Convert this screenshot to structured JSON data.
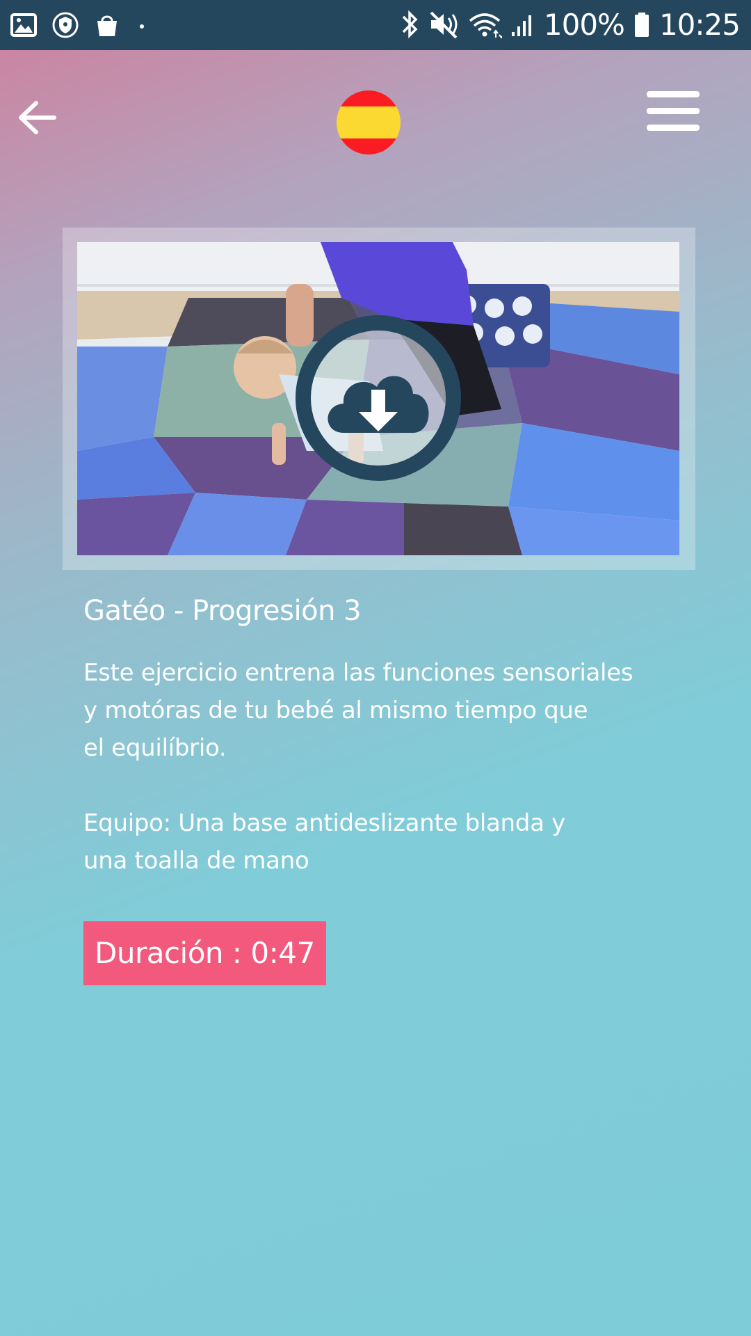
{
  "status_bar": {
    "battery_text": "100%",
    "time": "10:25",
    "icons_left": [
      "image-icon",
      "shield-icon",
      "shopping-bag-icon",
      "dot-icon"
    ],
    "icons_right": [
      "bluetooth-icon",
      "mute-icon",
      "wifi-icon",
      "signal-icon",
      "battery-icon"
    ]
  },
  "header": {
    "back_icon": "arrow-left-icon",
    "language_flag": "spain-flag-icon",
    "menu_icon": "hamburger-menu-icon"
  },
  "video": {
    "thumbnail": "baby-crawling-on-mat",
    "action_icon": "cloud-download-icon"
  },
  "exercise": {
    "title": "Gatéo - Progresión 3",
    "description_lines": [
      "Este ejercicio entrena las funciones sensoriales",
      "y motóras de tu bebé al mismo tiempo que",
      "el equilíbrio."
    ],
    "equipment_lines": [
      "Equipo: Una base antideslizante blanda y",
      "una toalla de mano"
    ],
    "duration_label": "Duración : 0:47"
  },
  "colors": {
    "status_bar": "#25475e",
    "duration_badge": "#f2597c",
    "download_button": "#25475e"
  }
}
